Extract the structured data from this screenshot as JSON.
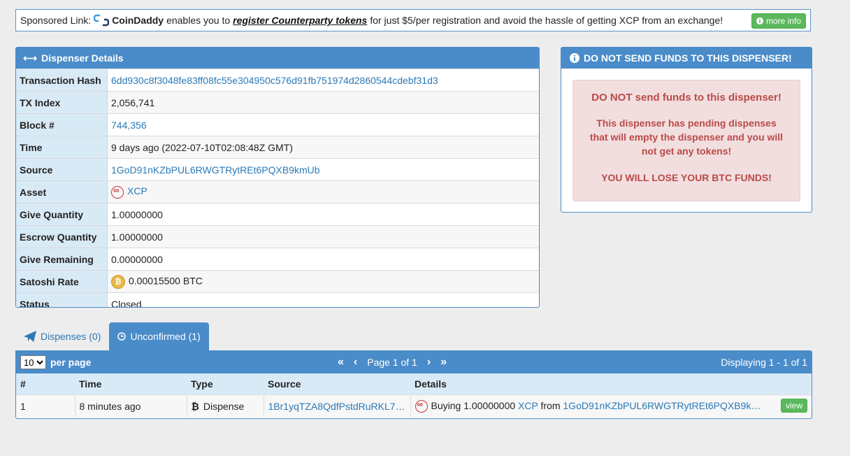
{
  "sponsor": {
    "prefix": "Sponsored Link:",
    "brand": "CoinDaddy",
    "text1": "enables you to",
    "link": "register Counterparty tokens",
    "text2": "for just $5/per registration and avoid the hassle of getting XCP from an exchange!",
    "button": "more info"
  },
  "details": {
    "title": "Dispenser Details",
    "rows": [
      {
        "key": "Transaction Hash",
        "value": "6dd930c8f3048fe83ff08fc55e304950c576d91fb751974d2860544cdebf31d3"
      },
      {
        "key": "TX Index",
        "value": "2,056,741"
      },
      {
        "key": "Block #",
        "value": "744,356"
      },
      {
        "key": "Time",
        "value": "9 days ago (2022-07-10T02:08:48Z GMT)"
      },
      {
        "key": "Source",
        "value": "1GoD91nKZbPUL6RWGTRytREt6PQXB9kmUb"
      },
      {
        "key": "Asset",
        "value": "XCP"
      },
      {
        "key": "Give Quantity",
        "value": "1.00000000"
      },
      {
        "key": "Escrow Quantity",
        "value": "1.00000000"
      },
      {
        "key": "Give Remaining",
        "value": "0.00000000"
      },
      {
        "key": "Satoshi Rate",
        "value": "0.00015500 BTC"
      },
      {
        "key": "Status",
        "value": "Closed"
      }
    ]
  },
  "warning": {
    "title": "DO NOT SEND FUNDS TO THIS DISPENSER!",
    "line1": "DO NOT send funds to this dispenser!",
    "line2": "This dispenser has pending dispenses that will empty the dispenser and you will not get any tokens!",
    "line3": "YOU WILL LOSE YOUR BTC FUNDS!"
  },
  "tabs": [
    {
      "label": "Dispenses (0)"
    },
    {
      "label": "Unconfirmed (1)"
    }
  ],
  "list": {
    "per_page_value": "10",
    "per_page_label": "per page",
    "page_text": "Page 1 of 1",
    "displaying": "Displaying 1 - 1 of 1",
    "columns": [
      "#",
      "Time",
      "Type",
      "Source",
      "Details"
    ],
    "row": {
      "num": "1",
      "time": "8 minutes ago",
      "type": "Dispense",
      "source": "1Br1yqTZA8QdfPstdRuRKL7…",
      "details_prefix": "Buying 1.00000000",
      "details_asset": "XCP",
      "details_from": "from",
      "details_address": "1GoD91nKZbPUL6RWGTRytREt6PQXB9k…",
      "view": "view"
    }
  },
  "colors": {
    "panel_blue": "#4a8cc9",
    "label_bg": "#d9eaf7",
    "link": "#2a7ab8",
    "green": "#5cb85c",
    "danger_text": "#b94a48",
    "danger_bg": "#f2dede"
  }
}
